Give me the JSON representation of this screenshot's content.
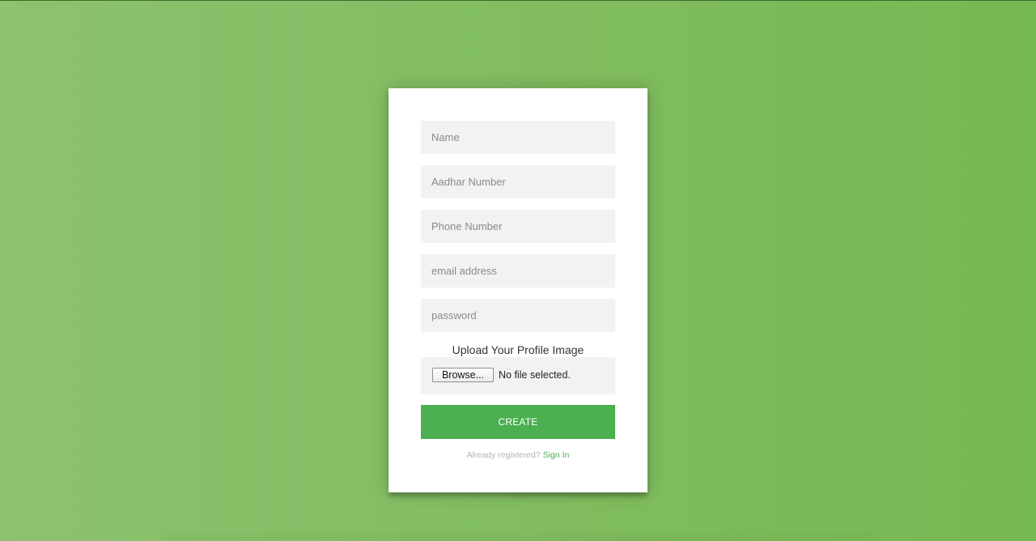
{
  "form": {
    "fields": [
      {
        "placeholder": "Name",
        "value": ""
      },
      {
        "placeholder": "Aadhar Number",
        "value": ""
      },
      {
        "placeholder": "Phone Number",
        "value": ""
      },
      {
        "placeholder": "email address",
        "value": ""
      },
      {
        "placeholder": "password",
        "value": ""
      }
    ],
    "upload_label": "Upload Your Profile Image",
    "browse_label": "Browse...",
    "file_status": "No file selected.",
    "create_label": "CREATE",
    "already_text": "Already registered?",
    "signin_label": "Sign In"
  },
  "colors": {
    "background_start": "#8DC26F",
    "background_end": "#76b852",
    "accent": "#4CAF50",
    "field_bg": "#f2f2f2",
    "card_bg": "#ffffff"
  }
}
